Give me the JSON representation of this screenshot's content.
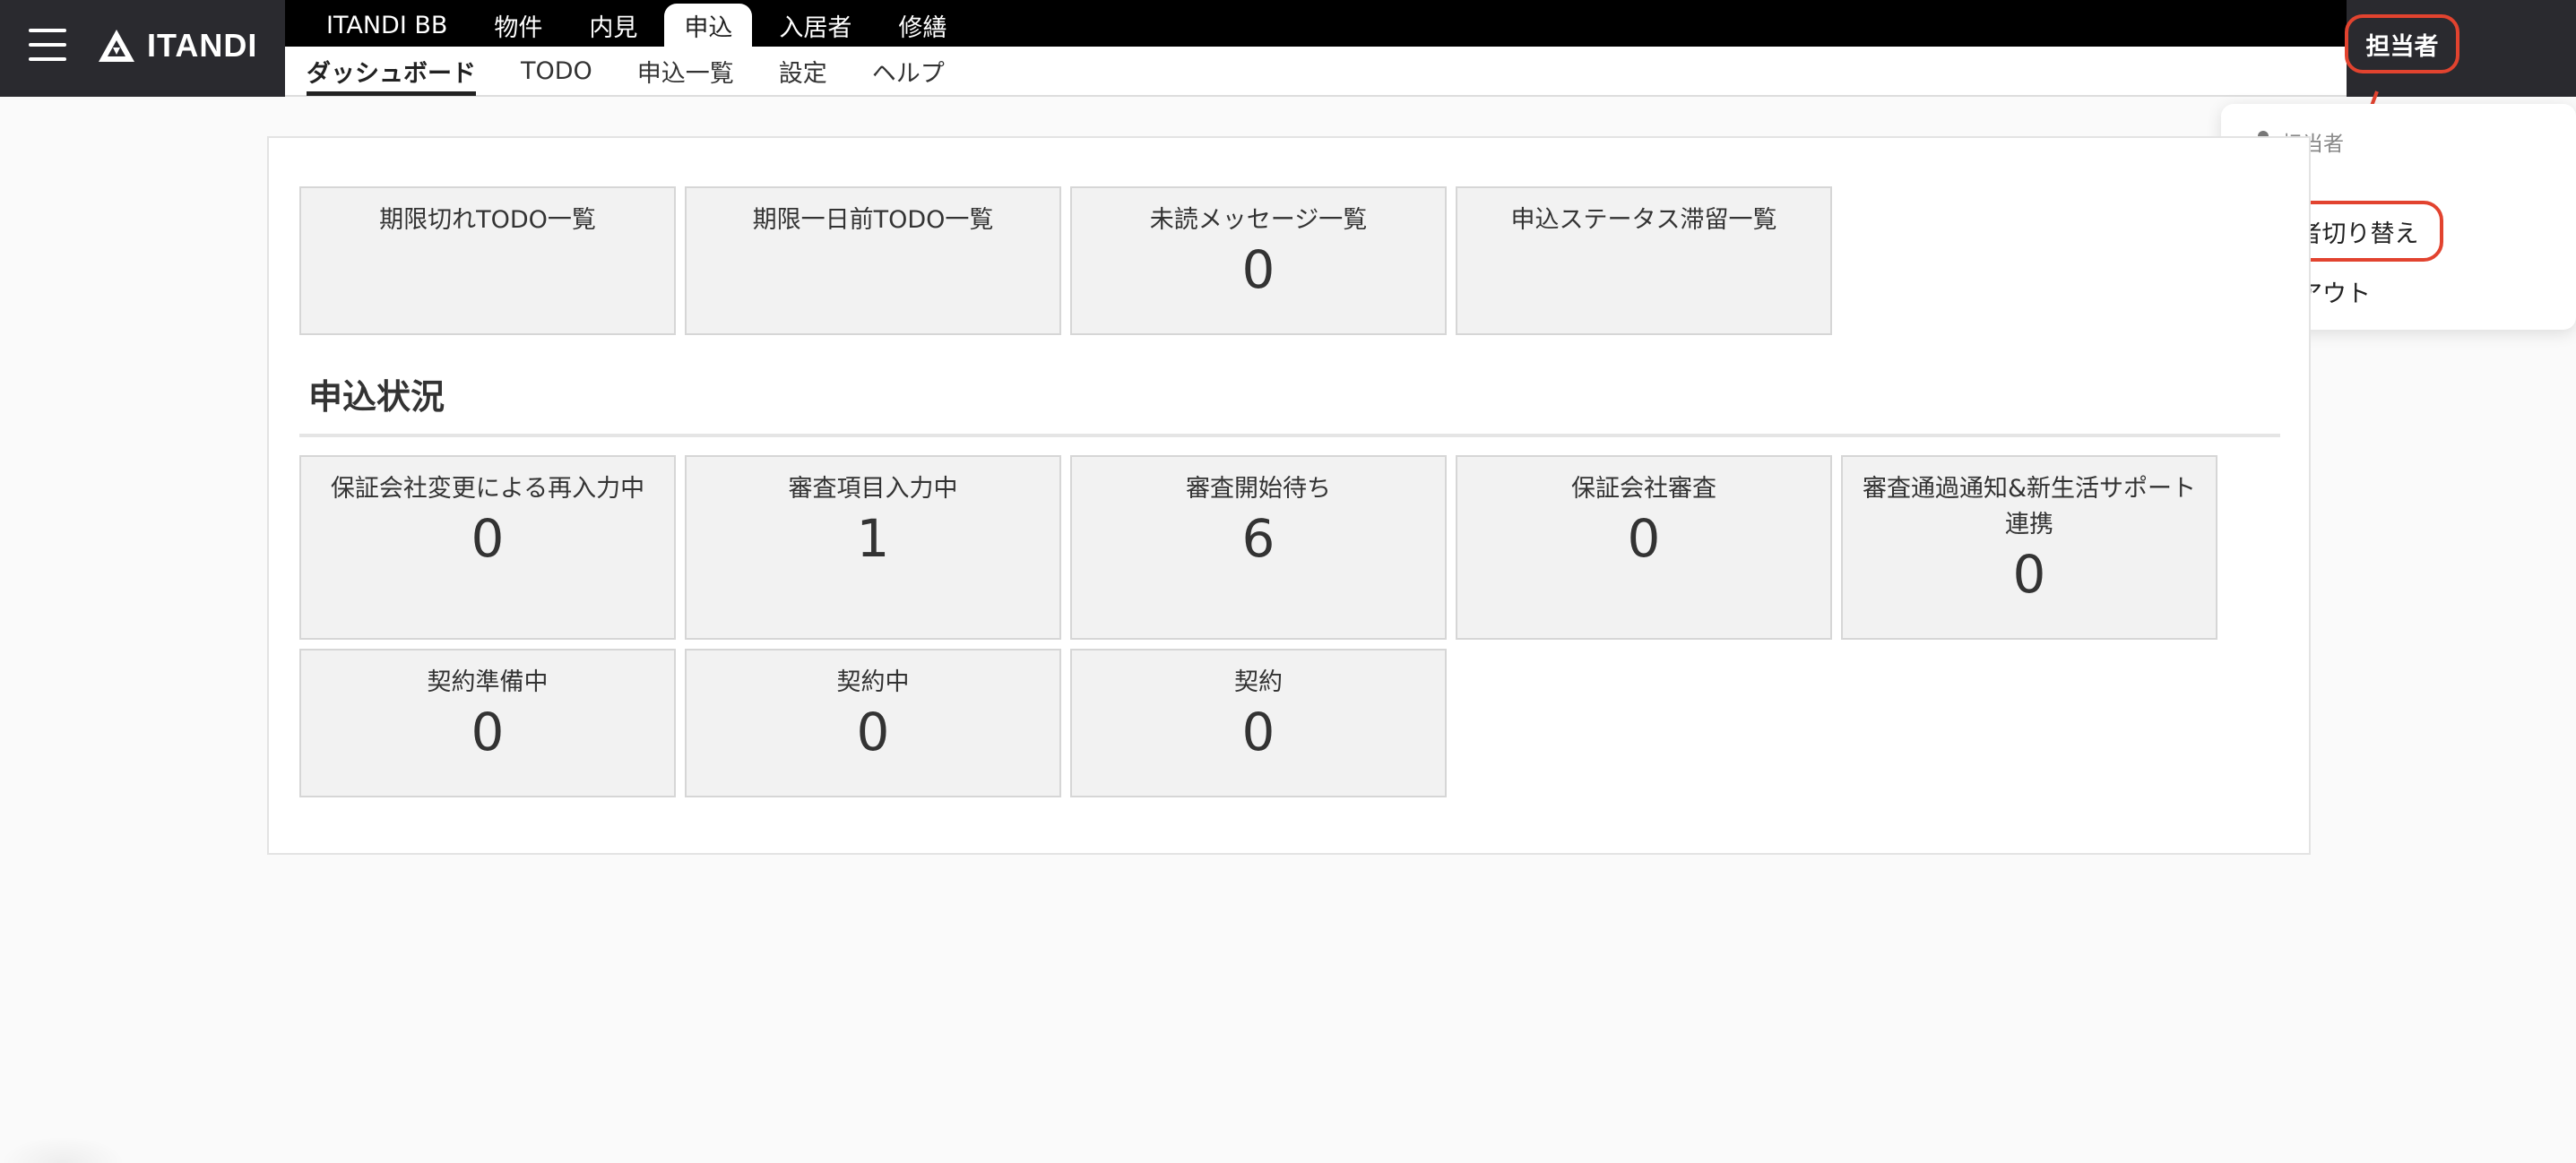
{
  "brand": {
    "name": "ITANDI"
  },
  "nav": {
    "top_tabs": [
      {
        "label": "ITANDI BB"
      },
      {
        "label": "物件"
      },
      {
        "label": "内見"
      },
      {
        "label": "申込"
      },
      {
        "label": "入居者"
      },
      {
        "label": "修繕"
      }
    ],
    "active_top_tab": "申込",
    "sub_tabs": [
      {
        "label": "ダッシュボード"
      },
      {
        "label": "TODO"
      },
      {
        "label": "申込一覧"
      },
      {
        "label": "設定"
      },
      {
        "label": "ヘルプ"
      }
    ],
    "active_sub_tab": "ダッシュボード"
  },
  "user_menu": {
    "button_label": "担当者",
    "header_label": "担当者",
    "items": [
      {
        "label": "担当者切り替え"
      },
      {
        "label": "ログアウト"
      }
    ]
  },
  "todo_cards": [
    {
      "label": "期限切れTODO一覧",
      "count": ""
    },
    {
      "label": "期限一日前TODO一覧",
      "count": ""
    },
    {
      "label": "未読メッセージ一覧",
      "count": "0"
    },
    {
      "label": "申込ステータス滞留一覧",
      "count": ""
    }
  ],
  "status_section": {
    "title": "申込状況",
    "cards": [
      {
        "label": "保証会社変更による再入力中",
        "count": "0"
      },
      {
        "label": "審査項目入力中",
        "count": "1"
      },
      {
        "label": "審査開始待ち",
        "count": "6"
      },
      {
        "label": "保証会社審査",
        "count": "0"
      },
      {
        "label": "審査通過通知&新生活サポート連携",
        "count": "0"
      },
      {
        "label": "契約準備中",
        "count": "0"
      },
      {
        "label": "契約中",
        "count": "0"
      },
      {
        "label": "契約",
        "count": "0"
      }
    ]
  },
  "colors": {
    "header_bg": "#2a2a2f",
    "nav_black": "#000000",
    "highlight_red": "#e2432f",
    "card_bg": "#f2f2f2"
  }
}
